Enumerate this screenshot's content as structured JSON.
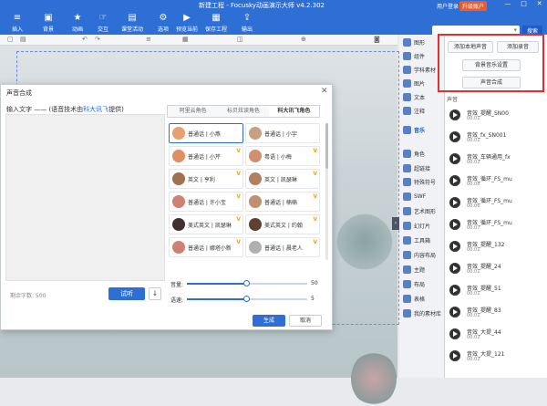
{
  "window": {
    "title": "新建工程 - Focusky动画演示大师 v4.2.302",
    "user": "用户登录",
    "upgrade": "升级账户",
    "controls": [
      "—",
      "□",
      "✕"
    ]
  },
  "toolbar": {
    "items": [
      {
        "label": "插入",
        "icon": "insert-icon"
      },
      {
        "label": "背景",
        "icon": "background-icon"
      },
      {
        "label": "动画",
        "icon": "animation-icon"
      },
      {
        "label": "交互",
        "icon": "interaction-icon"
      },
      {
        "label": "课堂活动",
        "icon": "classroom-icon"
      },
      {
        "label": "选项",
        "icon": "options-icon"
      },
      {
        "label": "预览当前",
        "icon": "preview-icon"
      },
      {
        "label": "保存工程",
        "icon": "save-icon"
      },
      {
        "label": "输出",
        "icon": "export-icon"
      }
    ],
    "search_button": "搜索"
  },
  "categories": [
    "图形",
    "组件",
    "学科素材",
    "图片",
    "文本",
    "注释",
    "音乐",
    "角色",
    "超链接",
    "特殊符号",
    "SWF",
    "艺术图形",
    "幻灯片",
    "工具箱",
    "内容布局",
    "主题",
    "布局",
    "表格",
    "我的素材库"
  ],
  "active_category": "音乐",
  "right_panel": {
    "buttons": {
      "add_local": "添加本地声音",
      "record": "添加录音",
      "bgm": "背景音乐设置",
      "synth": "声音合成"
    },
    "sounds_header": "声音",
    "sounds": [
      {
        "name": "音效_提醒_SN00",
        "len": "00:01"
      },
      {
        "name": "音效_fx_SN001",
        "len": "00:01"
      },
      {
        "name": "音效_车辆通用_fx",
        "len": "00:02"
      },
      {
        "name": "音效_循环_FS_mu",
        "len": "00:08"
      },
      {
        "name": "音效_循环_FS_mu",
        "len": "00:06"
      },
      {
        "name": "音效_循环_FS_mu",
        "len": "00:07"
      },
      {
        "name": "音效_提醒_132",
        "len": "00:01"
      },
      {
        "name": "音效_提醒_24",
        "len": "00:01"
      },
      {
        "name": "音效_提醒_51",
        "len": "00:01"
      },
      {
        "name": "音效_提醒_83",
        "len": "00:01"
      },
      {
        "name": "音效_大提_44",
        "len": "00:02"
      },
      {
        "name": "音效_大提_121",
        "len": "00:02"
      }
    ]
  },
  "dialog": {
    "title": "声音合成",
    "input_label_prefix": "输入文字 —— (语音技术由",
    "input_label_link": "科大讯飞",
    "input_label_suffix": "提供)",
    "remaining": "剩余字数: 500",
    "listen": "试听",
    "tabs": [
      "阿里云角色",
      "标贝炫读角色",
      "科大讯飞角色"
    ],
    "active_tab": 2,
    "voices": [
      {
        "name": "普通话 | 小燕",
        "color": "#e8a070"
      },
      {
        "name": "普通话 | 小宇",
        "color": "#c8a080"
      },
      {
        "name": "普通话 | 小芹",
        "color": "#e09060"
      },
      {
        "name": "粤语 | 小梅",
        "color": "#d09070"
      },
      {
        "name": "英文 | 亨利",
        "color": "#a07050"
      },
      {
        "name": "英文 | 凯瑟琳",
        "color": "#b08060"
      },
      {
        "name": "普通话 | 许小宝",
        "color": "#d08070"
      },
      {
        "name": "普通话 | 楠楠",
        "color": "#c09070"
      },
      {
        "name": "美式英文 | 凯瑟琳",
        "color": "#403030"
      },
      {
        "name": "美式英文 | 约翰",
        "color": "#604030"
      },
      {
        "name": "普通话 | 娜塔小新",
        "color": "#d08070"
      },
      {
        "name": "普通话 | 晨老人",
        "color": "#b0b0b0"
      }
    ],
    "volume_label": "音量:",
    "volume_value": "50",
    "volume_fraction": 0.5,
    "speed_label": "语速:",
    "speed_value": "5",
    "speed_fraction": 0.5,
    "generate": "生成",
    "cancel": "取消"
  }
}
